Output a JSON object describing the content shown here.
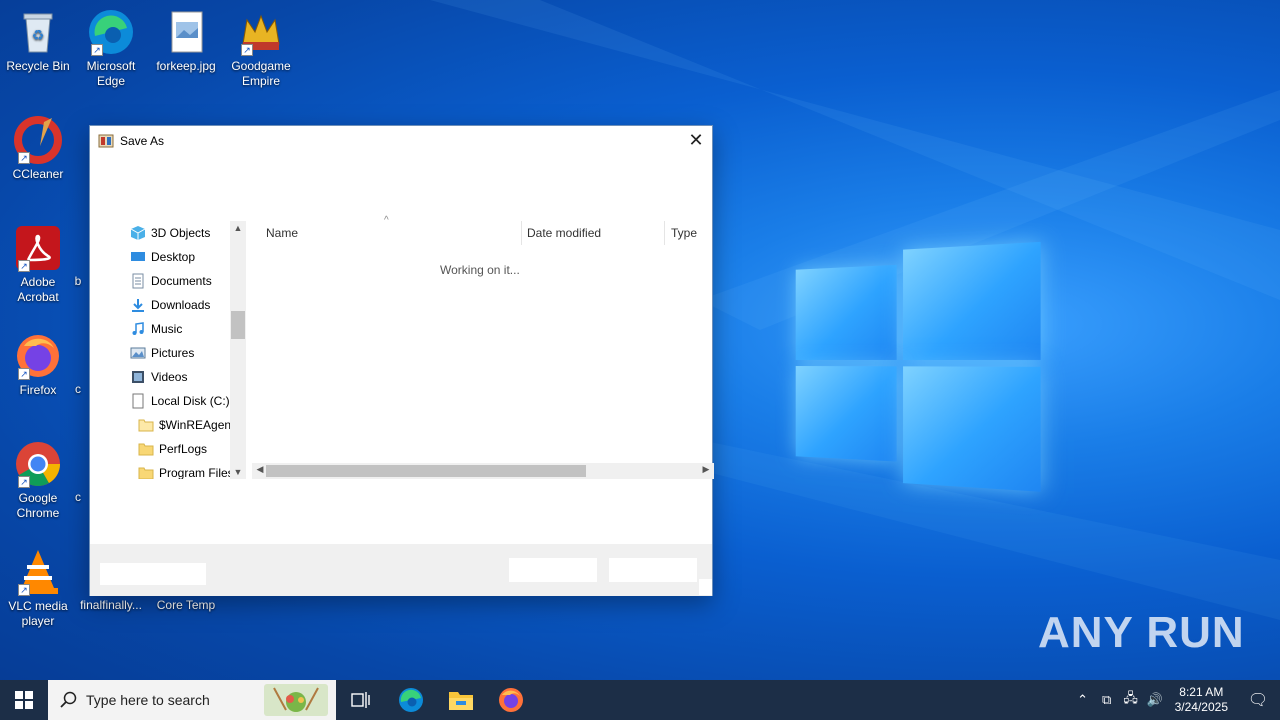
{
  "desktop": {
    "icons": [
      {
        "label": "Recycle Bin",
        "icon": "recycle-bin-icon"
      },
      {
        "label": "Microsoft Edge",
        "icon": "edge-icon"
      },
      {
        "label": "forkeep.jpg",
        "icon": "image-file-icon"
      },
      {
        "label": "Goodgame Empire",
        "icon": "crown-icon"
      },
      {
        "label": "CCleaner",
        "icon": "ccleaner-icon"
      },
      {
        "label": "Adobe Acrobat",
        "icon": "acrobat-icon"
      },
      {
        "label": "Firefox",
        "icon": "firefox-icon"
      },
      {
        "label": "Google Chrome",
        "icon": "chrome-icon"
      },
      {
        "label": "VLC media player",
        "icon": "vlc-icon"
      },
      {
        "label": "finalfinally...",
        "icon": "file-icon"
      },
      {
        "label": "Core Temp",
        "icon": "app-icon"
      }
    ],
    "partial_labels": [
      "b",
      "c",
      "c"
    ]
  },
  "dialog": {
    "title": "Save As",
    "nav_items": [
      {
        "label": "3D Objects",
        "icon": "3d-objects-icon"
      },
      {
        "label": "Desktop",
        "icon": "desktop-folder-icon"
      },
      {
        "label": "Documents",
        "icon": "documents-icon"
      },
      {
        "label": "Downloads",
        "icon": "downloads-icon"
      },
      {
        "label": "Music",
        "icon": "music-icon"
      },
      {
        "label": "Pictures",
        "icon": "pictures-icon"
      },
      {
        "label": "Videos",
        "icon": "videos-icon"
      },
      {
        "label": "Local Disk (C:)",
        "icon": "drive-icon"
      },
      {
        "label": "$WinREAgent",
        "icon": "folder-icon"
      },
      {
        "label": "PerfLogs",
        "icon": "folder-icon"
      },
      {
        "label": "Program Files",
        "icon": "folder-icon"
      }
    ],
    "columns": [
      "Name",
      "Date modified",
      "Type"
    ],
    "status": "Working on it..."
  },
  "taskbar": {
    "search_placeholder": "Type here to search",
    "time": "8:21 AM",
    "date": "3/24/2025"
  },
  "watermark": "ANY RUN",
  "colors": {
    "taskbar": "#1c2e47",
    "desktop": "#0a5fd0"
  }
}
